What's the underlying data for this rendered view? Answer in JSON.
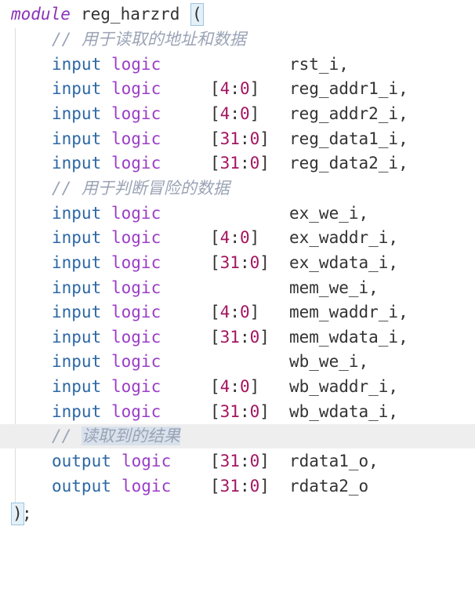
{
  "module_line": {
    "keyword": "module",
    "name": "reg_harzrd",
    "open_paren": "("
  },
  "lines": [
    {
      "kind": "comment",
      "text": "// 用于读取的地址和数据"
    },
    {
      "kind": "port",
      "dir": "input",
      "type": "logic",
      "range": null,
      "signal": "rst_i,"
    },
    {
      "kind": "port",
      "dir": "input",
      "type": "logic",
      "range": {
        "hi": "4",
        "lo": "0"
      },
      "signal": "reg_addr1_i,"
    },
    {
      "kind": "port",
      "dir": "input",
      "type": "logic",
      "range": {
        "hi": "4",
        "lo": "0"
      },
      "signal": "reg_addr2_i,"
    },
    {
      "kind": "port",
      "dir": "input",
      "type": "logic",
      "range": {
        "hi": "31",
        "lo": "0"
      },
      "signal": "reg_data1_i,"
    },
    {
      "kind": "port",
      "dir": "input",
      "type": "logic",
      "range": {
        "hi": "31",
        "lo": "0"
      },
      "signal": "reg_data2_i,"
    },
    {
      "kind": "comment",
      "text": "// 用于判断冒险的数据"
    },
    {
      "kind": "port",
      "dir": "input",
      "type": "logic",
      "range": null,
      "signal": "ex_we_i,"
    },
    {
      "kind": "port",
      "dir": "input",
      "type": "logic",
      "range": {
        "hi": "4",
        "lo": "0"
      },
      "signal": "ex_waddr_i,"
    },
    {
      "kind": "port",
      "dir": "input",
      "type": "logic",
      "range": {
        "hi": "31",
        "lo": "0"
      },
      "signal": "ex_wdata_i,"
    },
    {
      "kind": "port",
      "dir": "input",
      "type": "logic",
      "range": null,
      "signal": "mem_we_i,"
    },
    {
      "kind": "port",
      "dir": "input",
      "type": "logic",
      "range": {
        "hi": "4",
        "lo": "0"
      },
      "signal": "mem_waddr_i,"
    },
    {
      "kind": "port",
      "dir": "input",
      "type": "logic",
      "range": {
        "hi": "31",
        "lo": "0"
      },
      "signal": "mem_wdata_i,"
    },
    {
      "kind": "port",
      "dir": "input",
      "type": "logic",
      "range": null,
      "signal": "wb_we_i,"
    },
    {
      "kind": "port",
      "dir": "input",
      "type": "logic",
      "range": {
        "hi": "4",
        "lo": "0"
      },
      "signal": "wb_waddr_i,"
    },
    {
      "kind": "port",
      "dir": "input",
      "type": "logic",
      "range": {
        "hi": "31",
        "lo": "0"
      },
      "signal": "wb_wdata_i,"
    },
    {
      "kind": "comment",
      "text": "// 读取到的结果",
      "current": true,
      "selected_text": "读取到的结果"
    },
    {
      "kind": "port",
      "dir": "output",
      "type": "logic",
      "range": {
        "hi": "31",
        "lo": "0"
      },
      "signal": "rdata1_o,"
    },
    {
      "kind": "port",
      "dir": "output",
      "type": "logic",
      "range": {
        "hi": "31",
        "lo": "0"
      },
      "signal": "rdata2_o"
    }
  ],
  "closing_line": {
    "paren": ")",
    "semicolon": ";"
  },
  "colors": {
    "module_keyword": "#8a33b8",
    "direction_keyword": "#2c67a5",
    "type_keyword": "#9b3dc7",
    "number": "#a31560",
    "comment": "#9aa3b5",
    "current_line_bg": "#eeeeee",
    "bracket_match_bg": "#e4f0f8"
  }
}
